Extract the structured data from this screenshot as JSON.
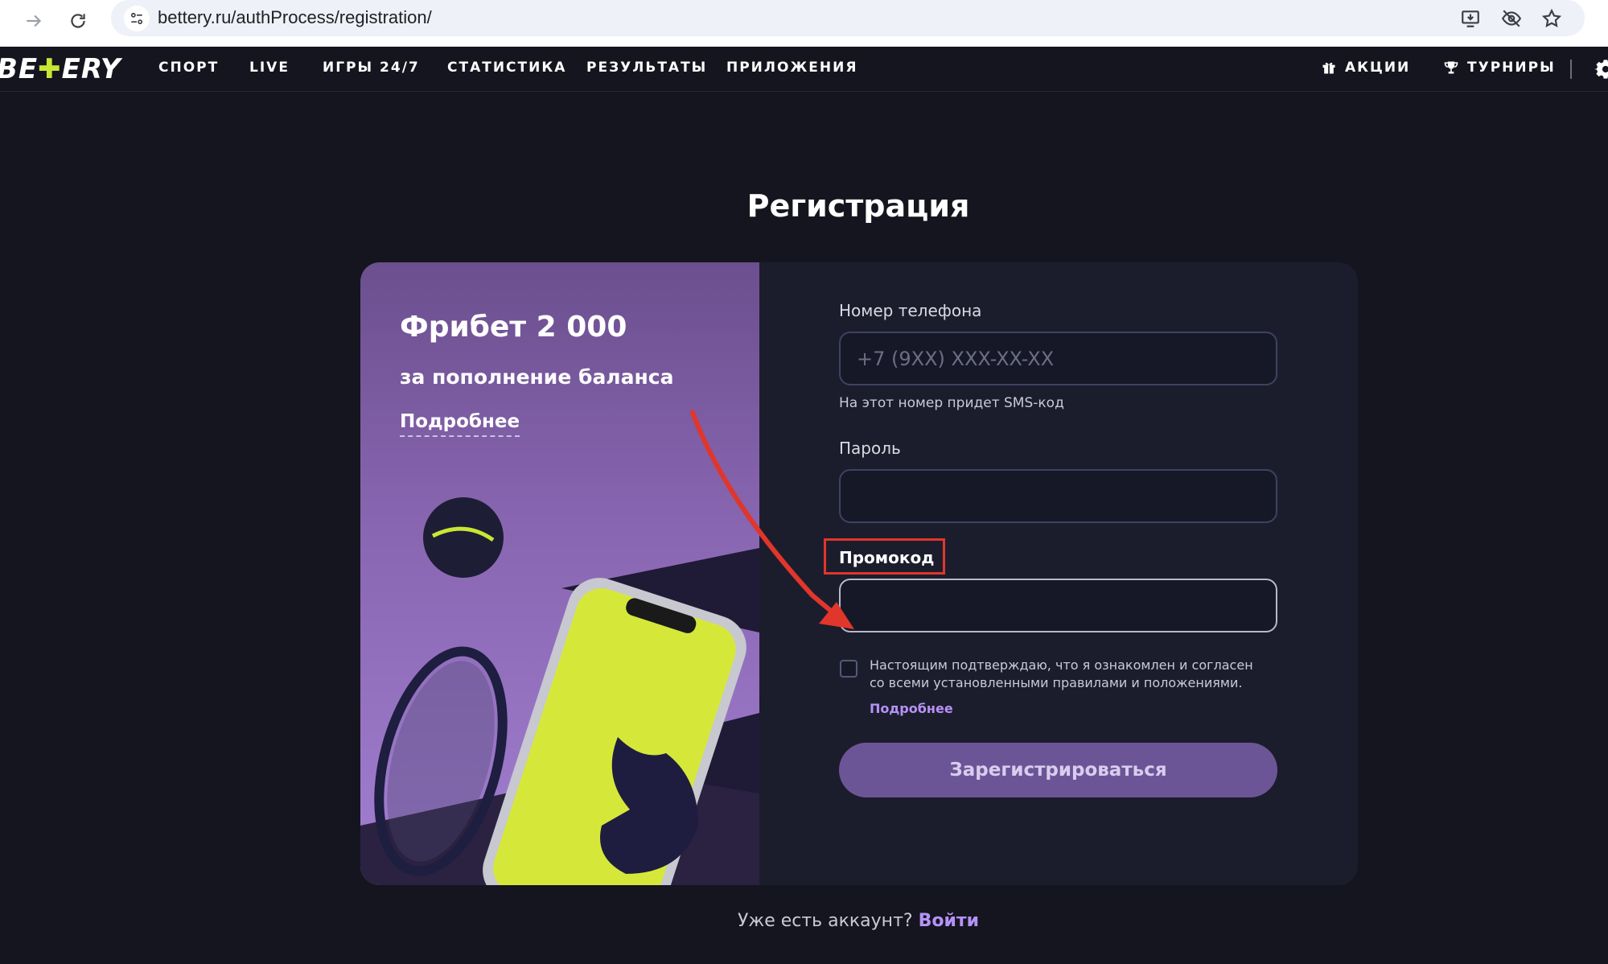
{
  "browser": {
    "url": "bettery.ru/authProcess/registration/"
  },
  "header": {
    "logo": "BETERY",
    "menu": [
      "СПОРТ",
      "LIVE",
      "ИГРЫ 24/7",
      "СТАТИСТИКА",
      "РЕЗУЛЬТАТЫ",
      "ПРИЛОЖЕНИЯ"
    ],
    "promotions_label": "АКЦИИ",
    "tournaments_label": "ТУРНИРЫ"
  },
  "page": {
    "title": "Регистрация"
  },
  "promo": {
    "title": "Фрибет 2 000",
    "subtitle": "за пополнение баланса",
    "link": "Подробнее"
  },
  "form": {
    "phone_label": "Номер телефона",
    "phone_placeholder": "+7 (9XX) XXX-XX-XX",
    "phone_hint": "На этот номер придет SMS-код",
    "password_label": "Пароль",
    "password_value": "",
    "promocode_label": "Промокод",
    "promocode_value": "",
    "consent_text": "Настоящим подтверждаю, что я ознакомлен и согласен со всеми установленными правилами и положениями.",
    "consent_link": "Подробнее",
    "submit_label": "Зарегистрироваться"
  },
  "footer": {
    "question": "Уже есть аккаунт?",
    "login_link": "Войти"
  },
  "colors": {
    "accent": "#b692f6",
    "button": "#6c5596",
    "annotation": "#e0362b",
    "logo_accent": "#c9e634"
  }
}
